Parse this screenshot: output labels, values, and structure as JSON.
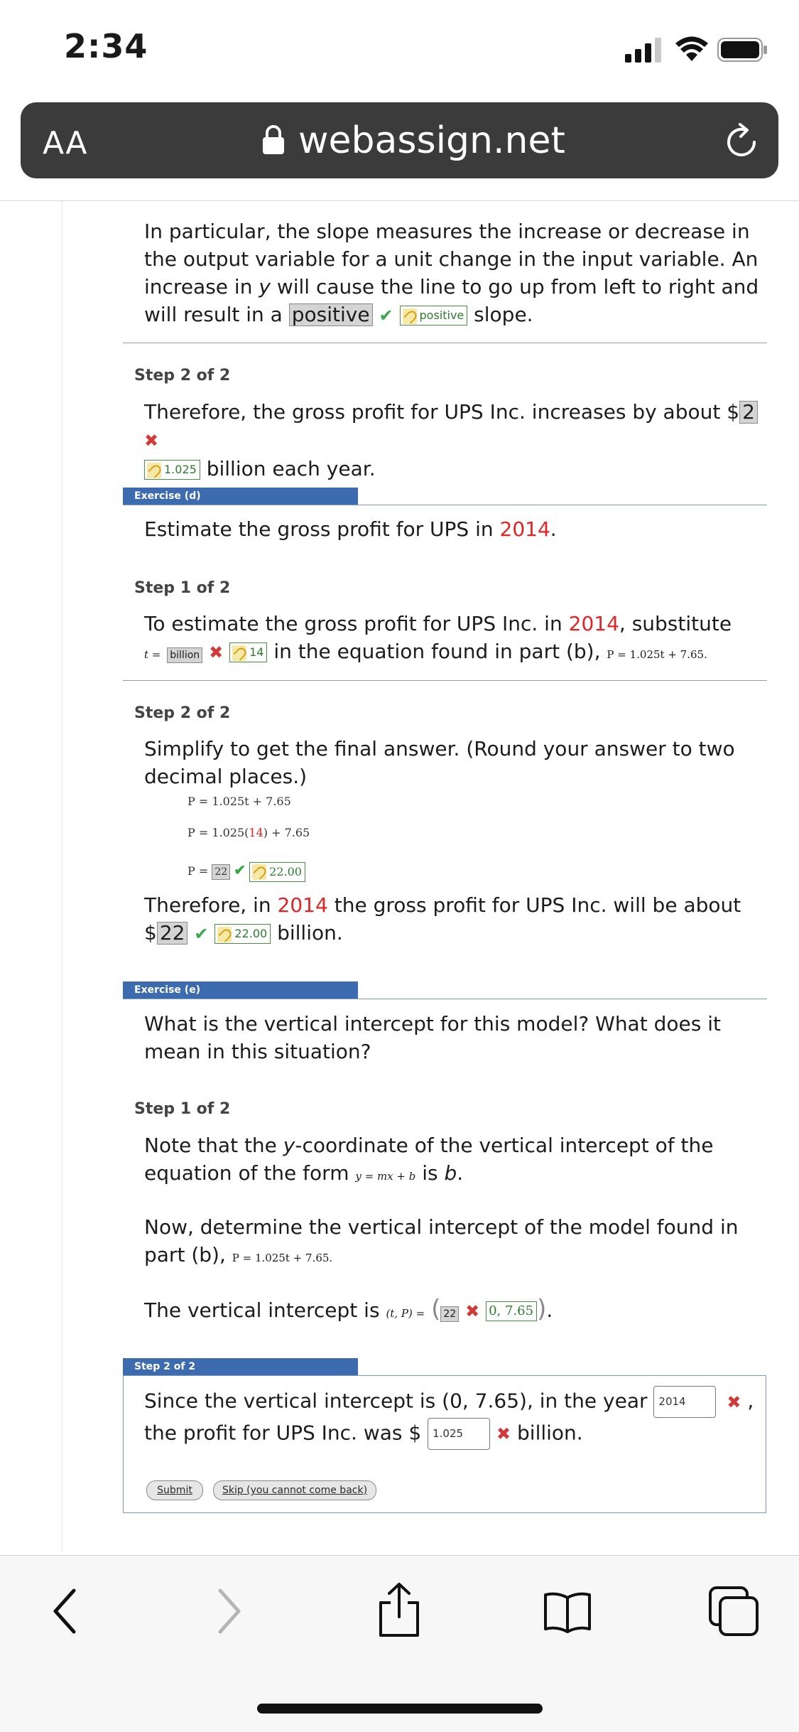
{
  "status": {
    "time": "2:34"
  },
  "browser": {
    "aa": "AA",
    "url": "webassign.net"
  },
  "part_c": {
    "para_prefix": "In particular, the slope measures the increase or decrease in the output variable for a unit change in the input variable. An increase in ",
    "para_var": "y",
    "para_mid": " will cause the line to go up from left to right and will result in a ",
    "response": "positive",
    "key": "positive",
    "para_suffix": " slope.",
    "step2_label": "Step 2 of 2",
    "step2_text": "Therefore, the gross profit for UPS Inc. increases by about $",
    "step2_response": "2",
    "step2_key": "1.025",
    "step2_suffix": " billion each year."
  },
  "exercise_d": {
    "label": "Exercise (d)",
    "question_prefix": "Estimate the gross profit for UPS in ",
    "question_year": "2014",
    "question_suffix": ".",
    "step1_label": "Step 1 of 2",
    "step1_prefix": "To estimate the gross profit for UPS Inc. in ",
    "step1_year": "2014",
    "step1_mid": ", substitute",
    "t_eq": "t =",
    "t_response": "billion",
    "t_key": "14",
    "step1_suffix": " in the equation found in part (b), ",
    "step1_eq": "P = 1.025t + 7.65.",
    "step2_label": "Step 2 of 2",
    "step2_text": "Simplify to get the final answer. (Round your answer to two decimal places.)",
    "eq1": "P = 1.025t + 7.65",
    "eq2_prefix": "P = 1.025(",
    "eq2_val": "14",
    "eq2_suffix": ") + 7.65",
    "eq3_prefix": "P =",
    "eq3_response": "22",
    "eq3_key": "22.00",
    "conclusion_prefix": "Therefore, in ",
    "conclusion_year": "2014",
    "conclusion_mid": " the gross profit for UPS Inc. will be about",
    "conclusion_dollar": "$",
    "conclusion_response": "22",
    "conclusion_key": "22.00",
    "conclusion_suffix": " billion."
  },
  "exercise_e": {
    "label": "Exercise (e)",
    "question": "What is the vertical intercept for this model? What does it mean in this situation?",
    "step1_label": "Step 1 of 2",
    "note_prefix": "Note that the ",
    "note_var": "y",
    "note_mid": "-coordinate of the vertical intercept of the equation of the form ",
    "note_eq": "y = mx + b",
    "note_suffix_is": " is ",
    "note_b": "b",
    "note_end": ".",
    "determine_text": "Now, determine the vertical intercept of the model found in part (b), ",
    "determine_eq": "P = 1.025t + 7.65.",
    "intercept_prefix": "The vertical intercept is ",
    "intercept_eq": "(t, P) =",
    "intercept_response": "22",
    "intercept_key": "0, 7.65",
    "step2_label": "Step 2 of 2",
    "since_prefix": "Since the vertical intercept is (0, 7.65), in the year",
    "year_input": "2014",
    "since_mid": "the profit for UPS Inc. was $",
    "profit_input": "1.025",
    "since_suffix": "billion.",
    "submit_label": "Submit",
    "skip_label": "Skip (you cannot come back)"
  },
  "toolbar": {
    "icons": [
      "back-icon",
      "forward-icon",
      "share-icon",
      "bookmarks-icon",
      "tabs-icon"
    ]
  }
}
